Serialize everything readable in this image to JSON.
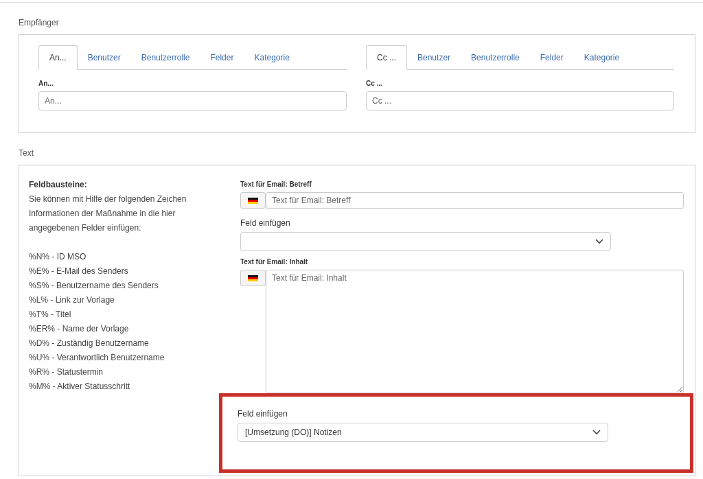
{
  "recipients": {
    "label": "Empfänger",
    "groups": [
      {
        "tabs": [
          {
            "label": "An...",
            "selected": true
          },
          {
            "label": "Benutzer",
            "selected": false
          },
          {
            "label": "Benutzerrolle",
            "selected": false
          },
          {
            "label": "Felder",
            "selected": false
          },
          {
            "label": "Kategorie",
            "selected": false
          }
        ],
        "field_label": "An...",
        "placeholder": "An..."
      },
      {
        "tabs": [
          {
            "label": "Cc ...",
            "selected": true
          },
          {
            "label": "Benutzer",
            "selected": false
          },
          {
            "label": "Benutzerrolle",
            "selected": false
          },
          {
            "label": "Felder",
            "selected": false
          },
          {
            "label": "Kategorie",
            "selected": false
          }
        ],
        "field_label": "Cc ...",
        "placeholder": "Cc ..."
      }
    ]
  },
  "text": {
    "label": "Text",
    "help": {
      "title": "Feldbausteine:",
      "intro": "Sie können mit Hilfe der folgenden Zeichen Informationen der Maßnahme in die hier angegebenen Felder einfügen:",
      "codes": [
        "%N% - ID MSO",
        "%E% - E-Mail des Senders",
        "%S% - Benutzername des Senders",
        "%L% - Link zur Vorlage",
        "%T% - Titel",
        "%ER% - Name der Vorlage",
        "%D% - Zuständig Benutzername",
        "%U% - Verantwortlich Benutzername",
        "%R% - Statustermin",
        "%M% - Aktiver Statusschritt"
      ]
    },
    "fields": [
      {
        "kind": "input",
        "label": "Text für Email: Betreff",
        "placeholder": "Text für Email: Betreff",
        "highlighted": false
      },
      {
        "kind": "select",
        "label": "Feld einfügen",
        "highlighted": false
      },
      {
        "kind": "textarea",
        "label": "Text für Email: Inhalt",
        "placeholder": "Text für Email: Inhalt",
        "highlighted": false
      },
      {
        "kind": "select",
        "label": "Feld einfügen",
        "value": "[Umsetzung (DO)] Notizen",
        "highlighted": true
      }
    ]
  }
}
